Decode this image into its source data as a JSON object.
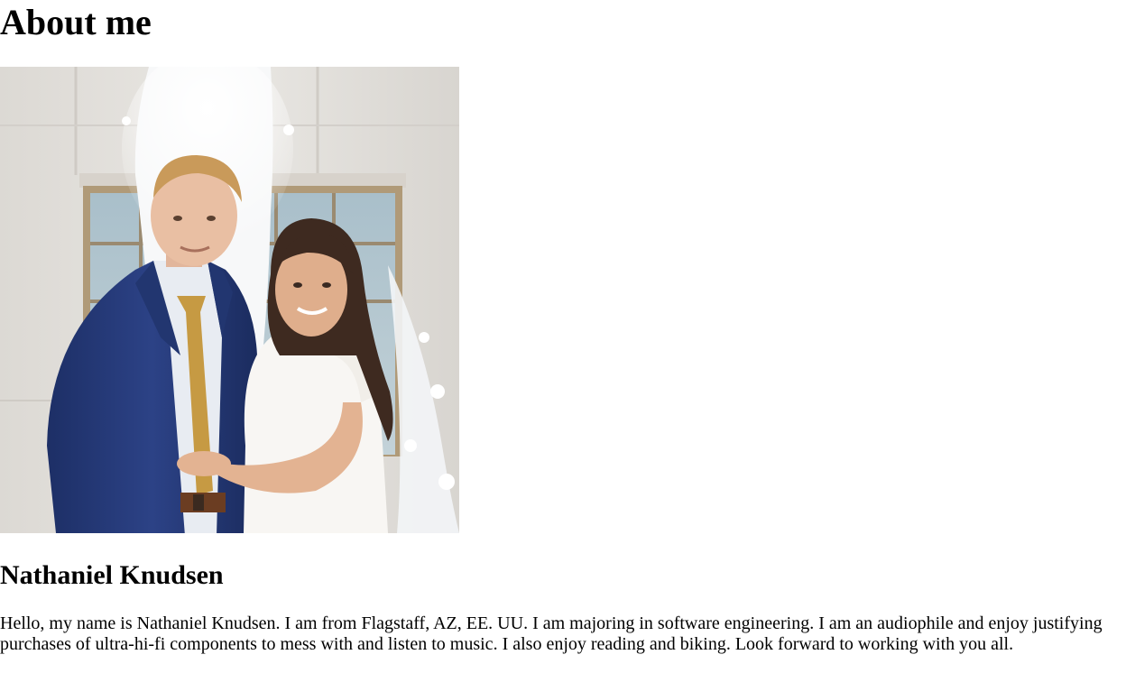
{
  "page": {
    "title": "About me"
  },
  "photo": {
    "alt": "Photo of a couple standing in front of a fountain"
  },
  "profile": {
    "name": "Nathaniel Knudsen",
    "bio": "Hello, my name is Nathaniel Knudsen. I am from Flagstaff, AZ, EE. UU. I am majoring in software engineering. I am an audiophile and enjoy justifying purchases of ultra-hi-fi components to mess with and listen to music. I also enjoy reading and biking. Look forward to working with you all."
  }
}
